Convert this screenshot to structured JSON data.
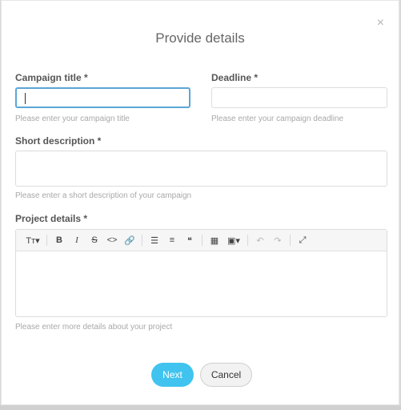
{
  "dialog": {
    "title": "Provide details",
    "close_glyph": "×"
  },
  "fields": {
    "campaign_title": {
      "label": "Campaign title *",
      "value": "",
      "help": "Please enter your campaign title"
    },
    "deadline": {
      "label": "Deadline *",
      "value": "",
      "help": "Please enter your campaign deadline"
    },
    "short_description": {
      "label": "Short description *",
      "value": "",
      "help": "Please enter a short description of your campaign"
    },
    "project_details": {
      "label": "Project details *",
      "value": "",
      "help": "Please enter more details about your project"
    }
  },
  "editor_toolbar": {
    "text_style": "Tт▾",
    "bold": "B",
    "italic": "I",
    "strike": "S",
    "code": "<>",
    "link": "🔗",
    "bullet_list": "☰",
    "numbered_list": "≡",
    "quote": "❝",
    "table": "▦",
    "image": "▣▾",
    "undo": "↶",
    "redo": "↷",
    "fullscreen": "⤢"
  },
  "buttons": {
    "next": "Next",
    "cancel": "Cancel"
  }
}
